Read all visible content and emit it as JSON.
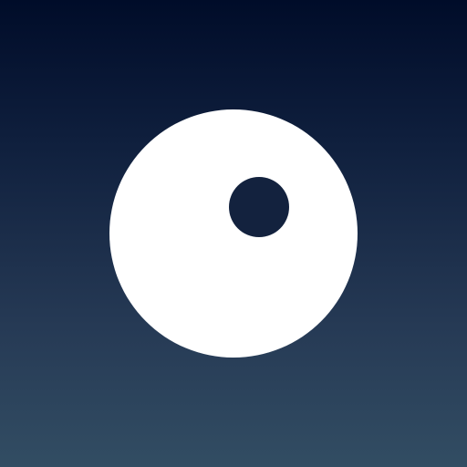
{
  "app_icon": {
    "logo_icon": "ring-with-offset-dot-icon",
    "colors": {
      "background_top": "#000c29",
      "background_bottom": "#324d63",
      "disc": "#ffffff",
      "hole": "#13223e"
    }
  }
}
